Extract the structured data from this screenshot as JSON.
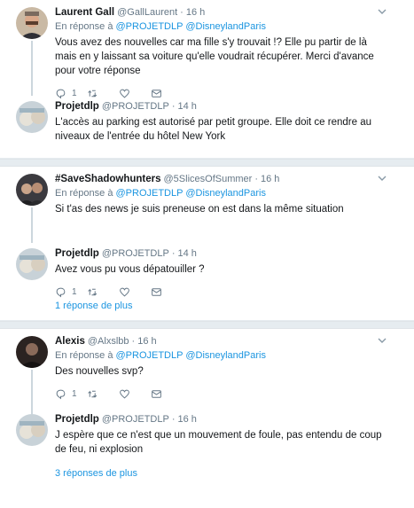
{
  "reply_to_prefix": "En réponse à",
  "threads": [
    {
      "tweets": [
        {
          "name": "Laurent Gall",
          "handle": "@GallLaurent",
          "time": "16 h",
          "mentions": [
            "@PROJETDLP",
            "@DisneylandParis"
          ],
          "text": "Vous avez des nouvelles car ma fille s'y trouvait !? Elle pu partir de là mais en y laissant sa voiture qu'elle voudrait récupérer. Merci d'avance pour votre réponse",
          "reply_count": "1"
        },
        {
          "name": "Projetdlp",
          "handle": "@PROJETDLP",
          "time": "14 h",
          "mentions": [],
          "text": "L'accès au parking est autorisé par petit groupe. Elle doit ce rendre au niveaux de l'entrée du hôtel New York",
          "reply_count": ""
        }
      ],
      "more_replies": ""
    },
    {
      "tweets": [
        {
          "name": "#SaveShadowhunters",
          "handle": "@5SlicesOfSummer",
          "time": "16 h",
          "mentions": [
            "@PROJETDLP",
            "@DisneylandParis"
          ],
          "text": "Si t'as des news je suis preneuse on est dans la même situation",
          "reply_count": ""
        },
        {
          "name": "Projetdlp",
          "handle": "@PROJETDLP",
          "time": "14 h",
          "mentions": [],
          "text": "Avez vous pu vous dépatouiller ?",
          "reply_count": "1"
        }
      ],
      "more_replies": "1 réponse de plus"
    },
    {
      "tweets": [
        {
          "name": "Alexis",
          "handle": "@Alxslbb",
          "time": "16 h",
          "mentions": [
            "@PROJETDLP",
            "@DisneylandParis"
          ],
          "text": "Des nouvelles svp?",
          "reply_count": "1"
        },
        {
          "name": "Projetdlp",
          "handle": "@PROJETDLP",
          "time": "16 h",
          "mentions": [],
          "text": "J espère que ce n'est que un mouvement de foule, pas entendu de coup de feu, ni explosion",
          "reply_count": ""
        }
      ],
      "more_replies": "3 réponses de plus"
    }
  ],
  "colors": {
    "link": "#1b95e0",
    "muted": "#657786",
    "text": "#14171a",
    "separator": "#e6ecf0"
  },
  "icons": [
    "reply-icon",
    "retweet-icon",
    "like-icon",
    "direct-message-icon",
    "chevron-down-icon"
  ]
}
